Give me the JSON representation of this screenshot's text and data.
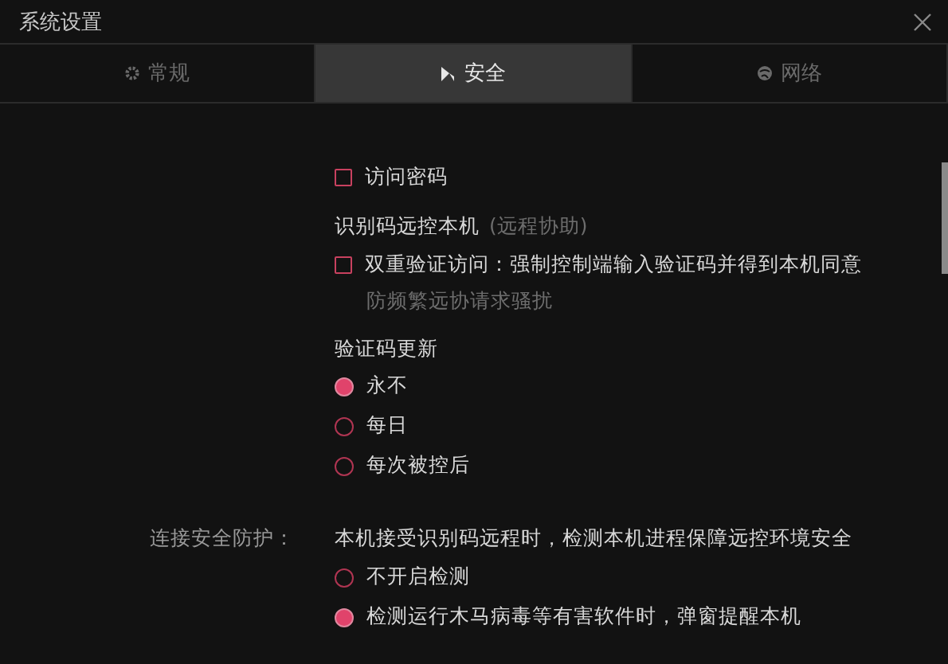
{
  "window": {
    "title": "系统设置"
  },
  "tabs": [
    {
      "label": "常规",
      "kind": "general",
      "selected": false
    },
    {
      "label": "安全",
      "kind": "security",
      "selected": true
    },
    {
      "label": "网络",
      "kind": "network",
      "selected": false
    }
  ],
  "access_password": {
    "label": "访问密码",
    "checked": false
  },
  "remote_by_code": {
    "title": "识别码远控本机",
    "note": "(远程协助)",
    "two_factor": {
      "label": "双重验证访问：强制控制端输入验证码并得到本机同意",
      "hint": "防频繁远协请求骚扰",
      "checked": false
    }
  },
  "code_refresh": {
    "title": "验证码更新",
    "options": [
      {
        "label": "永不",
        "selected": true
      },
      {
        "label": "每日",
        "selected": false
      },
      {
        "label": "每次被控后",
        "selected": false
      }
    ]
  },
  "connection_protection": {
    "label": "连接安全防护：",
    "description": "本机接受识别码远程时，检测本机进程保障远控环境安全",
    "options": [
      {
        "label": "不开启检测",
        "selected": false
      },
      {
        "label": "检测运行木马病毒等有害软件时，弹窗提醒本机",
        "selected": true
      }
    ]
  }
}
